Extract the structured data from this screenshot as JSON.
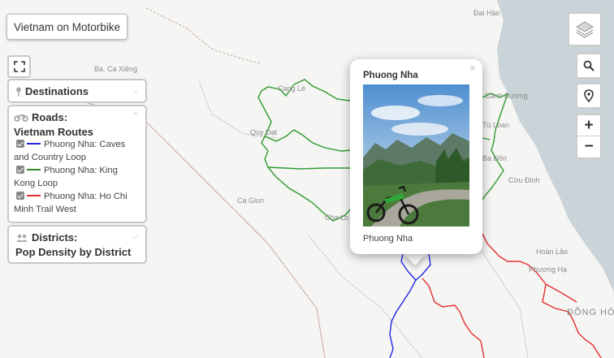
{
  "app_title": "Vietnam on Motorbike",
  "layers": {
    "destinations": {
      "title": "Destinations"
    },
    "roads": {
      "title": "Roads:",
      "subtitle": "Vietnam Routes",
      "items": [
        {
          "label": "Phuong Nha: Caves and Country Loop",
          "color": "#1f28e0",
          "checked": true
        },
        {
          "label": "Phuong Nha: King Kong Loop",
          "color": "#2a8a2a",
          "checked": true
        },
        {
          "label": "Phuong Nha: Ho Chi Minh Trail West",
          "color": "#e42a2a",
          "checked": true
        }
      ]
    },
    "districts": {
      "title": "Districts:",
      "subtitle": "Pop Density by District"
    }
  },
  "popup": {
    "title": "Phuong Nha",
    "caption": "Phuong Nha",
    "close": "×"
  },
  "map_controls": {
    "zoom_in": "+",
    "zoom_out": "−"
  },
  "place_labels": {
    "dai_hao": "Đại Hào",
    "ba_ca_xieng": "Ba. Ca Xiêng",
    "cang_le": "Cang Lé",
    "quy_dat": "Quy Đạt",
    "ca_giun": "Ca Giun",
    "cha_lo": "Cha Lo",
    "canh_duong": "Cảnh Dương",
    "tu_loan": "Tú Loan",
    "ba_don": "Ba Đồn",
    "cu_dinh": "Cừu Đinh",
    "hoan_lao": "Hoàn Lão",
    "phuong_ha": "Phương Hạ",
    "dong_hoi": "ĐỒNG HỚI"
  }
}
